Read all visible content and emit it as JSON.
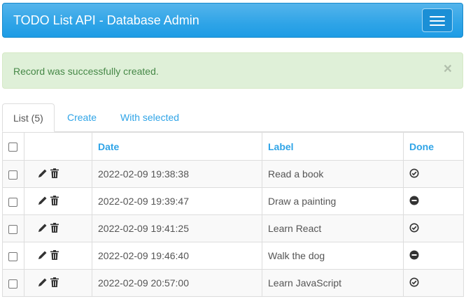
{
  "navbar": {
    "brand": "TODO List API - Database Admin",
    "menu_icon": "hamburger-menu-icon"
  },
  "alert": {
    "message": "Record was successfully created.",
    "close_glyph": "×"
  },
  "tabs": [
    {
      "label": "List (5)",
      "active": true
    },
    {
      "label": "Create",
      "active": false
    },
    {
      "label": "With selected",
      "active": false
    }
  ],
  "table": {
    "columns": {
      "date": "Date",
      "label": "Label",
      "done": "Done"
    },
    "action_icons": [
      "pencil-icon",
      "trash-icon"
    ],
    "done_icons": {
      "true": "check-circle-icon",
      "false": "minus-circle-icon"
    },
    "rows": [
      {
        "date": "2022-02-09 19:38:38",
        "label": "Read a book",
        "done": true
      },
      {
        "date": "2022-02-09 19:39:47",
        "label": "Draw a painting",
        "done": false
      },
      {
        "date": "2022-02-09 19:41:25",
        "label": "Learn React",
        "done": true
      },
      {
        "date": "2022-02-09 19:46:40",
        "label": "Walk the dog",
        "done": false
      },
      {
        "date": "2022-02-09 20:57:00",
        "label": "Learn JavaScript",
        "done": true
      }
    ]
  },
  "colors": {
    "primary": "#2fa4e7",
    "success_bg": "#dff0d8",
    "success_text": "#468847"
  }
}
